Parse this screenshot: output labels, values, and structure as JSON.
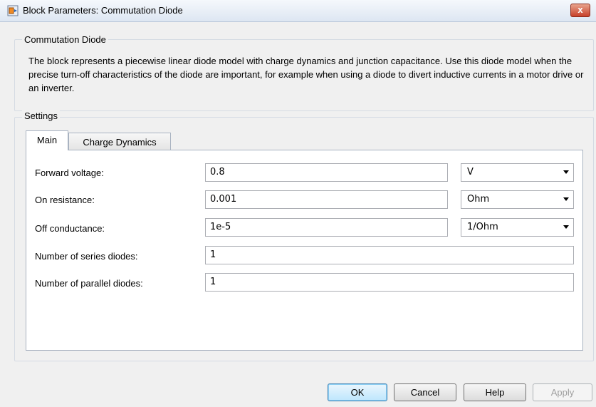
{
  "window": {
    "title": "Block Parameters: Commutation Diode",
    "close_label": "x"
  },
  "block": {
    "group_title": "Commutation Diode",
    "description": "The block represents a piecewise linear diode model with charge dynamics and junction capacitance. Use this diode model when the precise turn-off characteristics of the diode are important, for example when using a diode to divert inductive currents in a motor drive or an inverter."
  },
  "settings": {
    "group_title": "Settings",
    "tabs": [
      {
        "label": "Main",
        "active": true
      },
      {
        "label": "Charge Dynamics",
        "active": false
      }
    ],
    "params": [
      {
        "label": "Forward voltage:",
        "value": "0.8",
        "unit": "V"
      },
      {
        "label": "On resistance:",
        "value": "0.001",
        "unit": "Ohm"
      },
      {
        "label": "Off conductance:",
        "value": "1e-5",
        "unit": "1/Ohm"
      },
      {
        "label": "Number of series diodes:",
        "value": "1",
        "unit": null
      },
      {
        "label": "Number of parallel diodes:",
        "value": "1",
        "unit": null
      }
    ]
  },
  "buttons": {
    "ok": "OK",
    "cancel": "Cancel",
    "help": "Help",
    "apply": "Apply"
  }
}
